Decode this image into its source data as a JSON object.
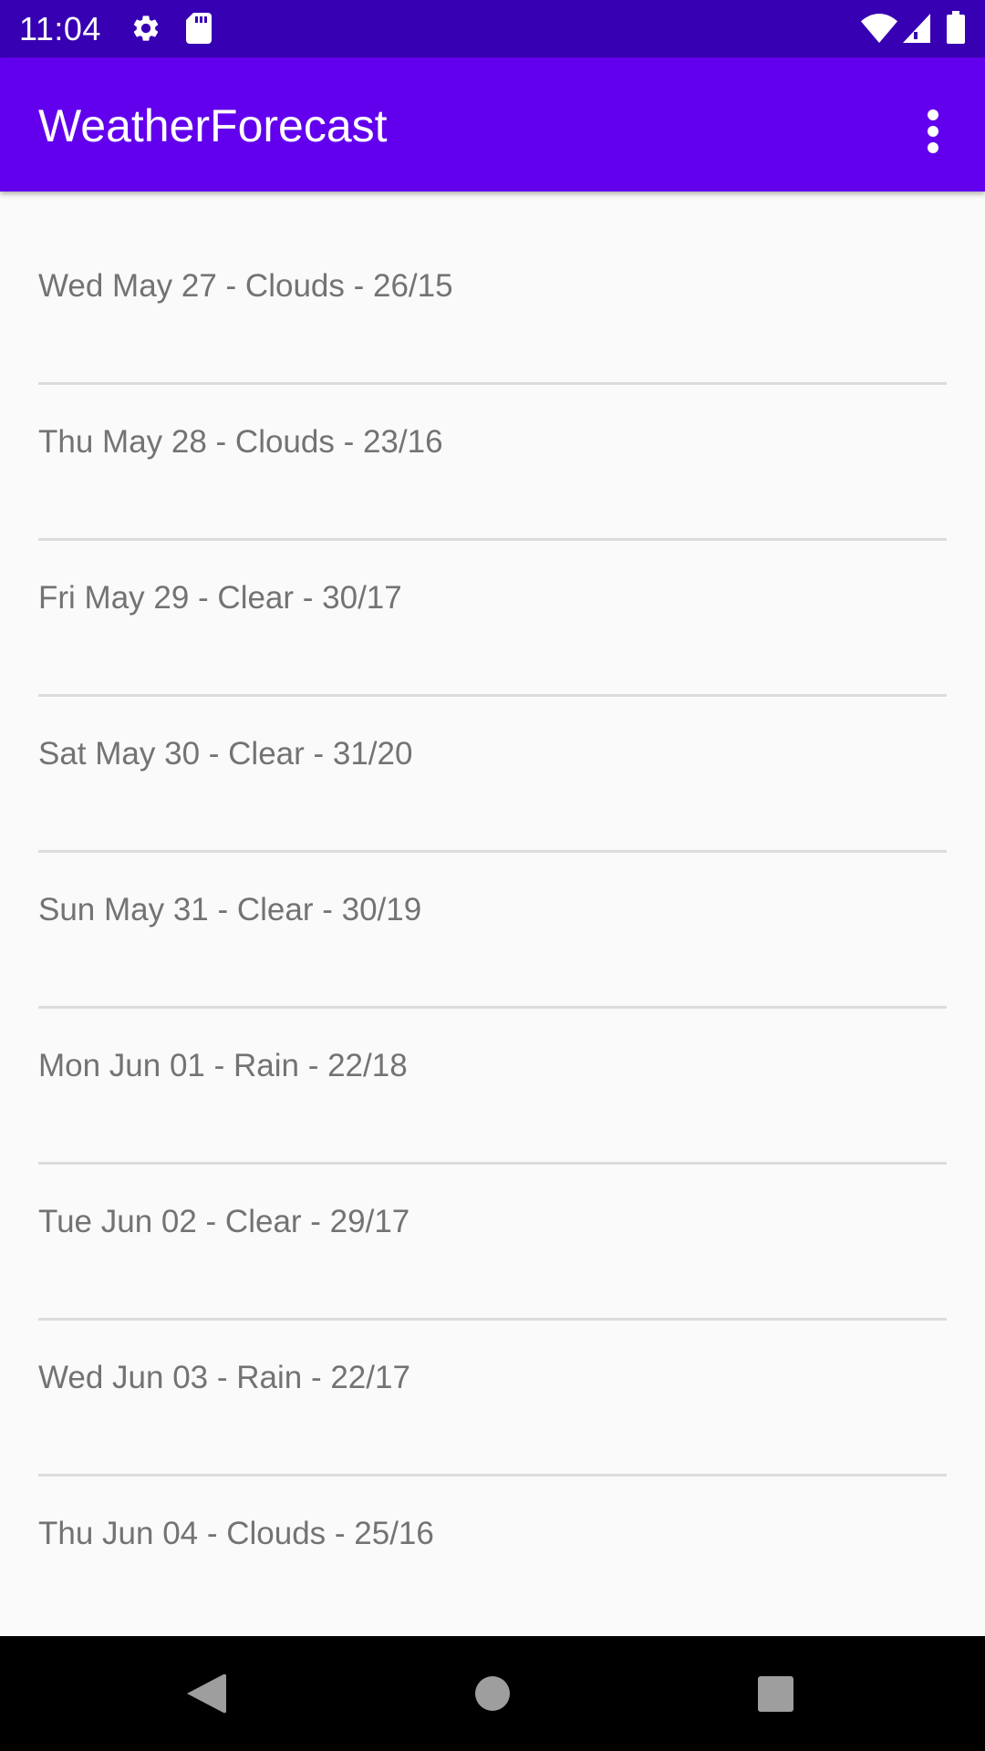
{
  "status_bar": {
    "time": "11:04",
    "icons_left": [
      "settings-gear-icon",
      "sd-card-icon"
    ],
    "icons_right": [
      "wifi-icon",
      "cell-signal-icon",
      "battery-icon"
    ]
  },
  "app_bar": {
    "title": "WeatherForecast",
    "overflow_icon": "more-vert-icon",
    "color": "#6200ee"
  },
  "forecast": {
    "items": [
      {
        "label": "Wed May 27 - Clouds - 26/15"
      },
      {
        "label": "Thu May 28 - Clouds - 23/16"
      },
      {
        "label": "Fri May 29 - Clear - 30/17"
      },
      {
        "label": "Sat May 30 - Clear - 31/20"
      },
      {
        "label": "Sun May 31 - Clear - 30/19"
      },
      {
        "label": "Mon Jun 01 - Rain - 22/18"
      },
      {
        "label": "Tue Jun 02 - Clear - 29/17"
      },
      {
        "label": "Wed Jun 03 - Rain - 22/17"
      },
      {
        "label": "Thu Jun 04 - Clouds - 25/16"
      }
    ]
  },
  "nav_bar": {
    "buttons": [
      "back-icon",
      "home-icon",
      "recents-icon"
    ]
  },
  "colors": {
    "status_bar": "#3700b3",
    "app_bar": "#6200ee",
    "background": "#fafafa",
    "text": "#737373",
    "divider": "#dcdcdc"
  }
}
